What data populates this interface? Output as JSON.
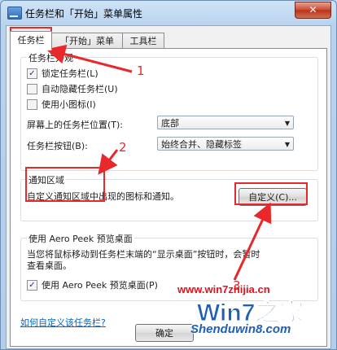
{
  "window": {
    "title": "任务栏和「开始」菜单属性",
    "close_glyph": "✕"
  },
  "tabs": [
    {
      "label": "任务栏",
      "active": true
    },
    {
      "label": "「开始」菜单",
      "active": false
    },
    {
      "label": "工具栏",
      "active": false
    }
  ],
  "appearance": {
    "group_label": "任务栏外观",
    "lock_taskbar": {
      "label": "锁定任务栏(L)",
      "checked": true
    },
    "autohide": {
      "label": "自动隐藏任务栏(U)",
      "checked": false
    },
    "small_icons": {
      "label": "使用小图标(I)",
      "checked": false
    },
    "location": {
      "label": "屏幕上的任务栏位置(T):",
      "value": "底部"
    },
    "buttons": {
      "label": "任务栏按钮(B):",
      "value": "始终合并、隐藏标签"
    }
  },
  "notification": {
    "group_label": "通知区域",
    "description": "自定义通知区域中出现的图标和通知。",
    "customize_button": "自定义(C)..."
  },
  "aero_peek": {
    "group_label": "使用 Aero Peek 预览桌面",
    "description_line1": "当您将鼠标移动到任务栏末端的“显示桌面”按钮时，会暂时",
    "description_line2": "查看桌面。",
    "checkbox": {
      "label": "使用 Aero Peek 预览桌面(P)",
      "checked": true
    }
  },
  "help_link": "如何自定义该任务栏?",
  "ok_button": "确定",
  "annotations": {
    "n1": "1",
    "n2": "2",
    "n3": "3",
    "accent": "#e8282a"
  },
  "watermark": {
    "site1": "www.win7zhijia.cn",
    "site2": "Shenduwin8.com",
    "logo_text": "Win7之家"
  }
}
